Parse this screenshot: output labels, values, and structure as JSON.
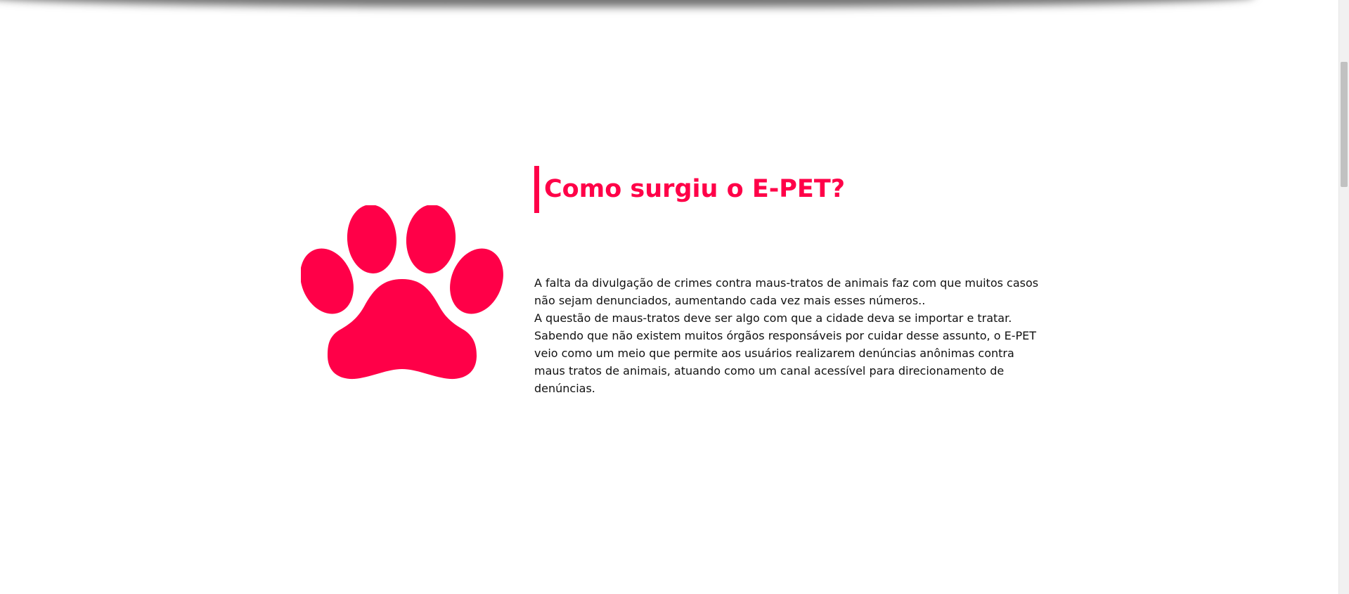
{
  "section": {
    "title": "Como surgiu o E-PET?",
    "paragraphs": [
      "A falta da divulgação de crimes contra maus-tratos de animais faz com que muitos casos não sejam denunciados, aumentando cada vez mais esses números..",
      "A questão de maus-tratos deve ser algo com que a cidade deva se importar e tratar.",
      "Sabendo que não existem muitos órgãos responsáveis por cuidar desse assunto, o E-PET veio como um meio que permite aos usuários realizarem denúncias anônimas contra maus tratos de animais, atuando como um canal acessível para direcionamento de denúncias."
    ],
    "icon": "paw-icon"
  },
  "colors": {
    "accent": "#ff0048",
    "text": "#111111",
    "background": "#ffffff"
  }
}
